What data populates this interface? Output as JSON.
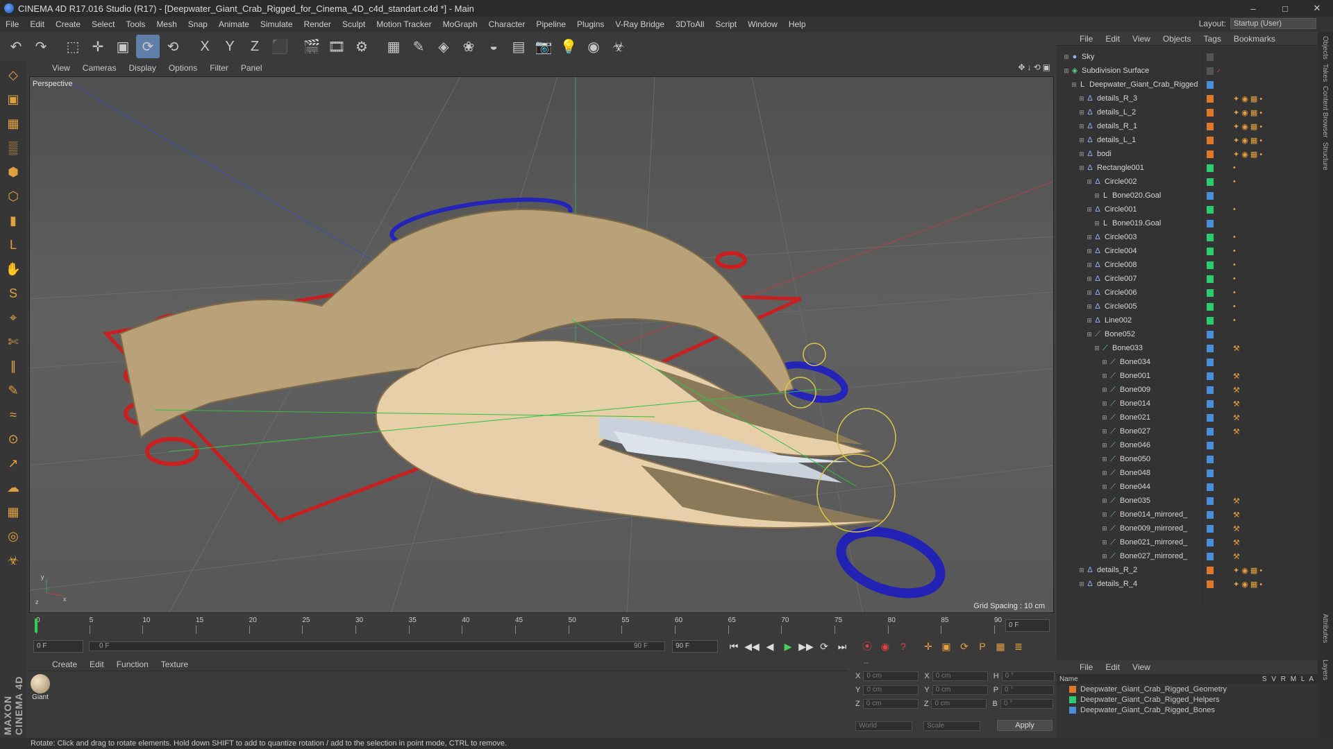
{
  "window": {
    "title": "CINEMA 4D R17.016 Studio (R17) - [Deepwater_Giant_Crab_Rigged_for_Cinema_4D_c4d_standart.c4d *] - Main",
    "controls": [
      "–",
      "□",
      "✕"
    ]
  },
  "menubar": {
    "items": [
      "File",
      "Edit",
      "Create",
      "Select",
      "Tools",
      "Mesh",
      "Snap",
      "Animate",
      "Simulate",
      "Render",
      "Sculpt",
      "Motion Tracker",
      "MoGraph",
      "Character",
      "Pipeline",
      "Plugins",
      "V-Ray Bridge",
      "3DToAll",
      "Script",
      "Window",
      "Help"
    ],
    "layout_label": "Layout:",
    "layout_value": "Startup (User)"
  },
  "toolbar": {
    "icons": [
      "undo-icon",
      "redo-icon",
      "live-select-icon",
      "move-icon",
      "scale-icon",
      "rotate-icon",
      "rotate-alt-icon",
      "x-axis-icon",
      "y-axis-icon",
      "z-axis-icon",
      "coordinate-system-icon",
      "render-view-icon",
      "render-picture-viewer-icon",
      "edit-render-settings-icon",
      "cube-icon",
      "pen-icon",
      "subdivision-icon",
      "array-icon",
      "deformer-icon",
      "floor-icon",
      "camera-icon",
      "light-icon",
      "scene-icon",
      "python-icon"
    ],
    "glyphs": [
      "↶",
      "↷",
      "⬚",
      "✛",
      "▣",
      "⟳",
      "⟲",
      "X",
      "Y",
      "Z",
      "⬛",
      "🎬",
      "🎞",
      "⚙",
      "▦",
      "✎",
      "◈",
      "❀",
      "◒",
      "▤",
      "📷",
      "💡",
      "◉",
      "☣"
    ]
  },
  "lefttools": {
    "icons": [
      "make-editable-icon",
      "model-mode-icon",
      "texture-mode-icon",
      "workplane-icon",
      "points-mode-icon",
      "edges-mode-icon",
      "polygons-mode-icon",
      "axis-mode-icon",
      "tweak-icon",
      "snap-icon",
      "magnet-icon",
      "knife-icon",
      "bridge-icon",
      "brush-icon",
      "iron-icon",
      "weld-icon",
      "extrude-icon",
      "smooth-icon",
      "grid-lock-icon",
      "workplane-lock-icon",
      "python-icon"
    ],
    "glyphs": [
      "◇",
      "▣",
      "▦",
      "▒",
      "⬢",
      "⬡",
      "▮",
      "L",
      "✋",
      "S",
      "⌖",
      "✄",
      "∥",
      "✎",
      "≈",
      "⊙",
      "↗",
      "☁",
      "▦",
      "◎",
      "☣"
    ],
    "maxon_logo": "MAXON CINEMA 4D"
  },
  "viewport": {
    "menu": [
      "View",
      "Cameras",
      "Display",
      "Options",
      "Filter",
      "Panel"
    ],
    "nav_icons": "✥↓⟲▣",
    "label": "Perspective",
    "grid_spacing": "Grid Spacing : 10 cm"
  },
  "timeline": {
    "ticks": [
      "0",
      "5",
      "10",
      "15",
      "20",
      "25",
      "30",
      "35",
      "40",
      "45",
      "50",
      "55",
      "60",
      "65",
      "70",
      "75",
      "80",
      "85",
      "90"
    ],
    "end_field": "0 F",
    "start_frame": "0 F",
    "slider_left": "0 F",
    "slider_right": "90 F",
    "end_frame": "90 F"
  },
  "transport": {
    "buttons": [
      "⏮",
      "◀◀",
      "◀",
      "▶",
      "▶▶",
      "⟳",
      "⏭"
    ],
    "record": [
      "⦿",
      "◉",
      "?"
    ],
    "keys": [
      "✛",
      "▣",
      "⟳",
      "P",
      "▦",
      "≣"
    ]
  },
  "material": {
    "menu": [
      "Create",
      "Edit",
      "Function",
      "Texture"
    ],
    "swatch_label": "Giant"
  },
  "coords": {
    "rows": [
      {
        "a": "X",
        "av": "0 cm",
        "b": "X",
        "bv": "0 cm",
        "c": "H",
        "cv": "0 °"
      },
      {
        "a": "Y",
        "av": "0 cm",
        "b": "Y",
        "bv": "0 cm",
        "c": "P",
        "cv": "0 °"
      },
      {
        "a": "Z",
        "av": "0 cm",
        "b": "Z",
        "bv": "0 cm",
        "c": "B",
        "cv": "0 °"
      }
    ],
    "mode": "World",
    "transform": "Scale",
    "apply": "Apply",
    "header": "--"
  },
  "status": "Rotate: Click and drag to rotate elements. Hold down SHIFT to add to quantize rotation / add to the selection in point mode, CTRL to remove.",
  "objects": {
    "menu": [
      "File",
      "Edit",
      "View",
      "Objects",
      "Tags",
      "Bookmarks"
    ],
    "rows": [
      {
        "name": "Sky",
        "indent": 0,
        "icon": "●",
        "icolor": "#8fb7e8",
        "col": "#555",
        "tags": "",
        "check": ""
      },
      {
        "name": "Subdivision Surface",
        "indent": 0,
        "icon": "◈",
        "icolor": "#5ad08a",
        "col": "#555",
        "tags": "",
        "check": "✓"
      },
      {
        "name": "Deepwater_Giant_Crab_Rigged",
        "indent": 1,
        "icon": "L",
        "icolor": "#ddd",
        "col": "#4a90d9",
        "tags": "",
        "check": ""
      },
      {
        "name": "details_R_3",
        "indent": 2,
        "icon": "∆",
        "icolor": "#8ab4f8",
        "col": "#e0782c",
        "tags": "✦ ◉ ▦ •",
        "check": ""
      },
      {
        "name": "details_L_2",
        "indent": 2,
        "icon": "∆",
        "icolor": "#8ab4f8",
        "col": "#e0782c",
        "tags": "✦ ◉ ▦ •",
        "check": ""
      },
      {
        "name": "details_R_1",
        "indent": 2,
        "icon": "∆",
        "icolor": "#8ab4f8",
        "col": "#e0782c",
        "tags": "✦ ◉ ▦ •",
        "check": ""
      },
      {
        "name": "details_L_1",
        "indent": 2,
        "icon": "∆",
        "icolor": "#8ab4f8",
        "col": "#e0782c",
        "tags": "✦ ◉ ▦ •",
        "check": ""
      },
      {
        "name": "bodi",
        "indent": 2,
        "icon": "∆",
        "icolor": "#8ab4f8",
        "col": "#e0782c",
        "tags": "✦ ◉ ▦ •",
        "check": ""
      },
      {
        "name": "Rectangle001",
        "indent": 2,
        "icon": "∆",
        "icolor": "#8ab4f8",
        "col": "#2ecc71",
        "tags": "•",
        "check": ""
      },
      {
        "name": "Circle002",
        "indent": 3,
        "icon": "∆",
        "icolor": "#8ab4f8",
        "col": "#2ecc71",
        "tags": "•",
        "check": ""
      },
      {
        "name": "Bone020.Goal",
        "indent": 4,
        "icon": "L",
        "icolor": "#ddd",
        "col": "#4a90d9",
        "tags": "",
        "check": ""
      },
      {
        "name": "Circle001",
        "indent": 3,
        "icon": "∆",
        "icolor": "#8ab4f8",
        "col": "#2ecc71",
        "tags": "•",
        "check": ""
      },
      {
        "name": "Bone019.Goal",
        "indent": 4,
        "icon": "L",
        "icolor": "#ddd",
        "col": "#4a90d9",
        "tags": "",
        "check": ""
      },
      {
        "name": "Circle003",
        "indent": 3,
        "icon": "∆",
        "icolor": "#8ab4f8",
        "col": "#2ecc71",
        "tags": "•",
        "check": ""
      },
      {
        "name": "Circle004",
        "indent": 3,
        "icon": "∆",
        "icolor": "#8ab4f8",
        "col": "#2ecc71",
        "tags": "•",
        "check": ""
      },
      {
        "name": "Circle008",
        "indent": 3,
        "icon": "∆",
        "icolor": "#8ab4f8",
        "col": "#2ecc71",
        "tags": "•",
        "check": ""
      },
      {
        "name": "Circle007",
        "indent": 3,
        "icon": "∆",
        "icolor": "#8ab4f8",
        "col": "#2ecc71",
        "tags": "•",
        "check": ""
      },
      {
        "name": "Circle006",
        "indent": 3,
        "icon": "∆",
        "icolor": "#8ab4f8",
        "col": "#2ecc71",
        "tags": "•",
        "check": ""
      },
      {
        "name": "Circle005",
        "indent": 3,
        "icon": "∆",
        "icolor": "#8ab4f8",
        "col": "#2ecc71",
        "tags": "•",
        "check": ""
      },
      {
        "name": "Line002",
        "indent": 3,
        "icon": "∆",
        "icolor": "#8ab4f8",
        "col": "#2ecc71",
        "tags": "•",
        "check": ""
      },
      {
        "name": "Bone052",
        "indent": 3,
        "icon": "⟋",
        "icolor": "#6bd58c",
        "col": "#4a90d9",
        "tags": "",
        "check": ""
      },
      {
        "name": "Bone033",
        "indent": 4,
        "icon": "⟋",
        "icolor": "#6bd58c",
        "col": "#4a90d9",
        "tags": "⚒",
        "check": ""
      },
      {
        "name": "Bone034",
        "indent": 5,
        "icon": "⟋",
        "icolor": "#6bd58c",
        "col": "#4a90d9",
        "tags": "",
        "check": ""
      },
      {
        "name": "Bone001",
        "indent": 5,
        "icon": "⟋",
        "icolor": "#6bd58c",
        "col": "#4a90d9",
        "tags": "⚒",
        "check": ""
      },
      {
        "name": "Bone009",
        "indent": 5,
        "icon": "⟋",
        "icolor": "#6bd58c",
        "col": "#4a90d9",
        "tags": "⚒",
        "check": ""
      },
      {
        "name": "Bone014",
        "indent": 5,
        "icon": "⟋",
        "icolor": "#6bd58c",
        "col": "#4a90d9",
        "tags": "⚒",
        "check": ""
      },
      {
        "name": "Bone021",
        "indent": 5,
        "icon": "⟋",
        "icolor": "#6bd58c",
        "col": "#4a90d9",
        "tags": "⚒",
        "check": ""
      },
      {
        "name": "Bone027",
        "indent": 5,
        "icon": "⟋",
        "icolor": "#6bd58c",
        "col": "#4a90d9",
        "tags": "⚒",
        "check": ""
      },
      {
        "name": "Bone046",
        "indent": 5,
        "icon": "⟋",
        "icolor": "#6bd58c",
        "col": "#4a90d9",
        "tags": "",
        "check": ""
      },
      {
        "name": "Bone050",
        "indent": 5,
        "icon": "⟋",
        "icolor": "#6bd58c",
        "col": "#4a90d9",
        "tags": "",
        "check": ""
      },
      {
        "name": "Bone048",
        "indent": 5,
        "icon": "⟋",
        "icolor": "#6bd58c",
        "col": "#4a90d9",
        "tags": "",
        "check": ""
      },
      {
        "name": "Bone044",
        "indent": 5,
        "icon": "⟋",
        "icolor": "#6bd58c",
        "col": "#4a90d9",
        "tags": "",
        "check": ""
      },
      {
        "name": "Bone035",
        "indent": 5,
        "icon": "⟋",
        "icolor": "#6bd58c",
        "col": "#4a90d9",
        "tags": "⚒",
        "check": ""
      },
      {
        "name": "Bone014_mirrored_",
        "indent": 5,
        "icon": "⟋",
        "icolor": "#6bd58c",
        "col": "#4a90d9",
        "tags": "⚒",
        "check": ""
      },
      {
        "name": "Bone009_mirrored_",
        "indent": 5,
        "icon": "⟋",
        "icolor": "#6bd58c",
        "col": "#4a90d9",
        "tags": "⚒",
        "check": ""
      },
      {
        "name": "Bone021_mirrored_",
        "indent": 5,
        "icon": "⟋",
        "icolor": "#6bd58c",
        "col": "#4a90d9",
        "tags": "⚒",
        "check": ""
      },
      {
        "name": "Bone027_mirrored_",
        "indent": 5,
        "icon": "⟋",
        "icolor": "#6bd58c",
        "col": "#4a90d9",
        "tags": "⚒",
        "check": ""
      },
      {
        "name": "details_R_2",
        "indent": 2,
        "icon": "∆",
        "icolor": "#8ab4f8",
        "col": "#e0782c",
        "tags": "✦ ◉ ▦ •",
        "check": ""
      },
      {
        "name": "details_R_4",
        "indent": 2,
        "icon": "∆",
        "icolor": "#8ab4f8",
        "col": "#e0782c",
        "tags": "✦ ◉ ▦ •",
        "check": ""
      }
    ]
  },
  "layers": {
    "menu": [
      "File",
      "Edit",
      "View"
    ],
    "header_name": "Name",
    "header_cols": "S V R M L A",
    "rows": [
      {
        "name": "Deepwater_Giant_Crab_Rigged_Geometry",
        "color": "#e0782c"
      },
      {
        "name": "Deepwater_Giant_Crab_Rigged_Helpers",
        "color": "#2ecc71"
      },
      {
        "name": "Deepwater_Giant_Crab_Rigged_Bones",
        "color": "#4a90d9"
      }
    ]
  },
  "right_tabs": [
    "Objects",
    "Takes",
    "Content Browser",
    "Structure",
    "Attributes",
    "Layers"
  ]
}
